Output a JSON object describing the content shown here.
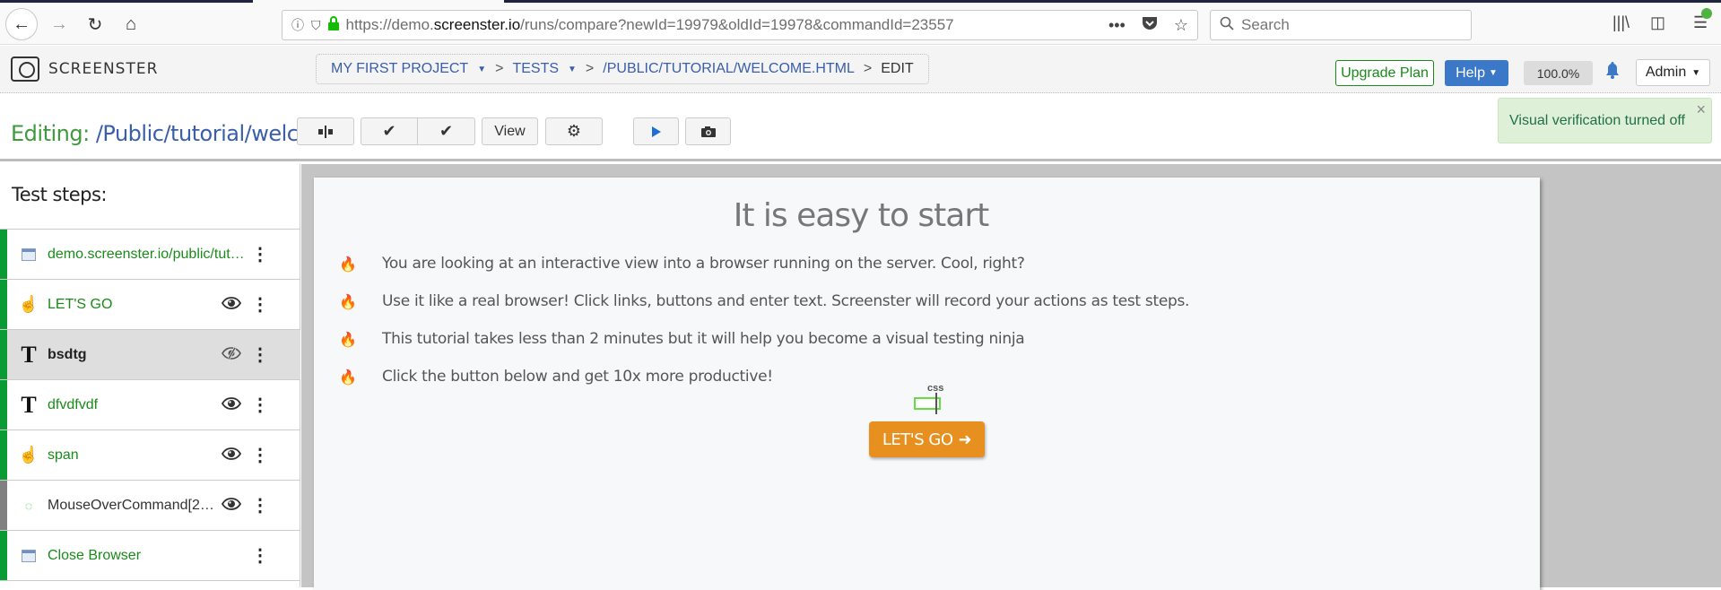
{
  "browser": {
    "url_prefix": "https://demo.",
    "url_domain": "screenster.io",
    "url_suffix": "/runs/compare?newId=19979&oldId=19978&commandId=23557",
    "search_placeholder": "Search",
    "icons": {
      "back": "←",
      "forward": "→",
      "reload": "↻",
      "home": "⌂",
      "info": "ⓘ",
      "shield": "⛉",
      "lock": "🔒",
      "more": "•••",
      "pocket": "⛛",
      "star": "☆",
      "search": "⚲",
      "library": "|||\\",
      "sidebar": "◫",
      "menu": "☰"
    }
  },
  "header": {
    "logo_text": "SCREENSTER",
    "breadcrumb": {
      "project": "MY FIRST PROJECT",
      "tests": "TESTS",
      "path": "/PUBLIC/TUTORIAL/WELCOME.HTML",
      "edit": "EDIT",
      "separator": ">",
      "caret": "▼"
    },
    "upgrade_label": "Upgrade Plan",
    "help_label": "Help",
    "zoom_level": "100.0%",
    "admin_label": "Admin"
  },
  "editbar": {
    "editing_key": "Editing:",
    "editing_value": "/Public/tutorial/welc...",
    "view_label": "View"
  },
  "toast": {
    "message": "Visual verification turned off",
    "close": "×"
  },
  "sidebar": {
    "title": "Test steps:",
    "steps": [
      {
        "label": "demo.screenster.io/public/tut…",
        "icon": "window",
        "status": "green",
        "eye": false
      },
      {
        "label": "LET'S GO",
        "icon": "click",
        "status": "green",
        "eye": true
      },
      {
        "label": "bsdtg",
        "icon": "text",
        "status": "green",
        "eye": true,
        "eye_off": true,
        "active": true
      },
      {
        "label": "dfvdfvdf",
        "icon": "text",
        "status": "green",
        "eye": true
      },
      {
        "label": "span",
        "icon": "click",
        "status": "green",
        "eye": true
      },
      {
        "label": "MouseOverCommand[2…",
        "icon": "hover",
        "status": "grey",
        "eye": true
      },
      {
        "label": "Close Browser",
        "icon": "window",
        "status": "green",
        "eye": false
      }
    ]
  },
  "page": {
    "heading": "It is easy to start",
    "bullets": [
      "You are looking at an interactive view into a browser running on the server. Cool, right?",
      "Use it like a real browser! Click links, buttons and enter text. Screenster will record your actions as test steps.",
      "This tutorial takes less than 2 minutes but it will help you become a visual testing ninja",
      "Click the button below and get 10x more productive!"
    ],
    "css_marker": "css",
    "button_label": "LET'S GO",
    "button_arrow": "➜"
  },
  "colors": {
    "accent_green": "#1a8a1a",
    "accent_blue": "#3c78c8",
    "status_green": "#0a9b35",
    "cta_orange": "#e8901f"
  }
}
